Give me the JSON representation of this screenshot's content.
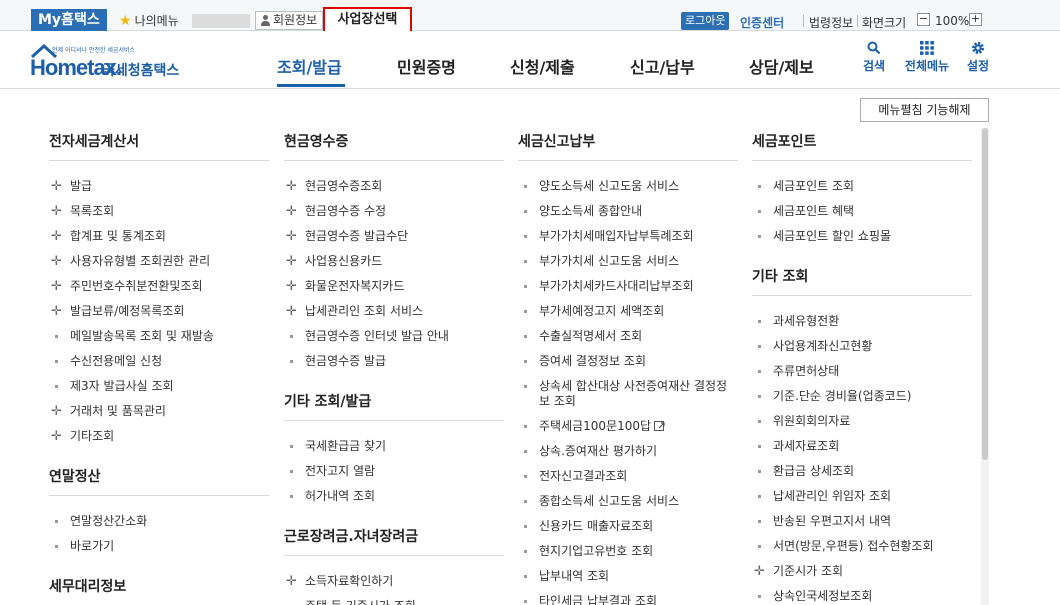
{
  "topbar": {
    "my_hometax": "My홈택스",
    "my_menu": "나의메뉴",
    "member_info": "회원정보",
    "business_select": "사업장선택",
    "logout": "로그아웃",
    "cert_center": "인증센터",
    "law_info": "법령정보",
    "screen_size": "화면크기",
    "zoom_minus": "−",
    "zoom_value": "100%",
    "zoom_plus": "+"
  },
  "header": {
    "logo_sub": "언제 어디서나 안전한 세금서비스",
    "logo_home": "Hometax.",
    "logo_kr": "국세청홈택스",
    "nav": [
      "조회/발급",
      "민원증명",
      "신청/제출",
      "신고/납부",
      "상담/제보"
    ],
    "icons": [
      {
        "label": "검색",
        "icon": "search-icon"
      },
      {
        "label": "전체메뉴",
        "icon": "grid-icon"
      },
      {
        "label": "설정",
        "icon": "gear-icon"
      }
    ]
  },
  "unfold_button": "메뉴펼침 기능해제",
  "columns": [
    {
      "sections": [
        {
          "title": "전자세금계산서",
          "items": [
            {
              "label": "발급",
              "type": "plus"
            },
            {
              "label": "목록조회",
              "type": "plus"
            },
            {
              "label": "합계표 및 통계조회",
              "type": "plus"
            },
            {
              "label": "사용자유형별 조회권한 관리",
              "type": "plus"
            },
            {
              "label": "주민번호수취분전환및조회",
              "type": "plus"
            },
            {
              "label": "발급보류/예정목록조회",
              "type": "plus"
            },
            {
              "label": "메일발송목록 조회 및 재발송",
              "type": "dot"
            },
            {
              "label": "수신전용메일 신청",
              "type": "dot"
            },
            {
              "label": "제3자 발급사실 조회",
              "type": "dot"
            },
            {
              "label": "거래처 및 품목관리",
              "type": "plus"
            },
            {
              "label": "기타조회",
              "type": "plus"
            }
          ]
        },
        {
          "title": "연말정산",
          "items": [
            {
              "label": "연말정산간소화",
              "type": "dot"
            },
            {
              "label": "바로가기",
              "type": "dot"
            }
          ]
        },
        {
          "title": "세무대리정보",
          "items": []
        }
      ]
    },
    {
      "sections": [
        {
          "title": "현금영수증",
          "items": [
            {
              "label": "현금영수증조회",
              "type": "plus"
            },
            {
              "label": "현금영수증 수정",
              "type": "plus"
            },
            {
              "label": "현금영수증 발급수단",
              "type": "plus"
            },
            {
              "label": "사업용신용카드",
              "type": "plus"
            },
            {
              "label": "화물운전자복지카드",
              "type": "plus"
            },
            {
              "label": "납세관리인 조회 서비스",
              "type": "plus"
            },
            {
              "label": "현금영수증 인터넷 발급 안내",
              "type": "dot"
            },
            {
              "label": "현금영수증 발급",
              "type": "dot"
            }
          ]
        },
        {
          "title": "기타 조회/발급",
          "items": [
            {
              "label": "국세환급금 찾기",
              "type": "dot"
            },
            {
              "label": "전자고지 열람",
              "type": "dot"
            },
            {
              "label": "허가내역 조회",
              "type": "dot"
            }
          ]
        },
        {
          "title": "근로장려금.자녀장려금",
          "items": [
            {
              "label": "소득자료확인하기",
              "type": "plus"
            },
            {
              "label": "주택 등 기준시가 조회",
              "type": "dot"
            }
          ]
        }
      ]
    },
    {
      "sections": [
        {
          "title": "세금신고납부",
          "items": [
            {
              "label": "양도소득세 신고도움 서비스",
              "type": "dot"
            },
            {
              "label": "양도소득세 종합안내",
              "type": "dot"
            },
            {
              "label": "부가가치세매입자납부특례조회",
              "type": "dot"
            },
            {
              "label": "부가가치세 신고도움 서비스",
              "type": "dot"
            },
            {
              "label": "부가가치세카드사대리납부조회",
              "type": "dot"
            },
            {
              "label": "부가세예정고지 세액조회",
              "type": "dot"
            },
            {
              "label": "수출실적명세서 조회",
              "type": "dot"
            },
            {
              "label": "증여세 결정정보 조회",
              "type": "dot"
            },
            {
              "label": "상속세 합산대상 사전증여재산 결정정보 조회",
              "type": "dot",
              "wrap": true
            },
            {
              "label": "주택세금100문100답",
              "type": "dot",
              "external": true
            },
            {
              "label": "상속.증여재산 평가하기",
              "type": "dot"
            },
            {
              "label": "전자신고결과조회",
              "type": "dot"
            },
            {
              "label": "종합소득세 신고도움 서비스",
              "type": "dot"
            },
            {
              "label": "신용카드 매출자료조회",
              "type": "dot"
            },
            {
              "label": "현지기업고유번호 조회",
              "type": "dot"
            },
            {
              "label": "납부내역 조회",
              "type": "dot"
            },
            {
              "label": "타인세금 납부결과 조회",
              "type": "dot"
            }
          ]
        }
      ]
    },
    {
      "sections": [
        {
          "title": "세금포인트",
          "items": [
            {
              "label": "세금포인트 조회",
              "type": "dot"
            },
            {
              "label": "세금포인트 혜택",
              "type": "dot"
            },
            {
              "label": "세금포인트 할인 쇼핑몰",
              "type": "dot"
            }
          ]
        },
        {
          "title": "기타 조회",
          "items": [
            {
              "label": "과세유형전환",
              "type": "dot"
            },
            {
              "label": "사업용계좌신고현황",
              "type": "dot"
            },
            {
              "label": "주류면허상태",
              "type": "dot"
            },
            {
              "label": "기준.단순 경비율(업종코드)",
              "type": "dot"
            },
            {
              "label": "위원회회의자료",
              "type": "dot"
            },
            {
              "label": "과세자료조회",
              "type": "dot"
            },
            {
              "label": "환급금 상세조회",
              "type": "dot"
            },
            {
              "label": "납세관리인 위임자 조회",
              "type": "dot"
            },
            {
              "label": "반송된 우편고지서 내역",
              "type": "dot"
            },
            {
              "label": "서면(방문,우편등) 접수현황조회",
              "type": "dot"
            },
            {
              "label": "기준시가 조회",
              "type": "plus"
            },
            {
              "label": "상속인국세정보조회",
              "type": "dot"
            }
          ]
        }
      ]
    }
  ]
}
